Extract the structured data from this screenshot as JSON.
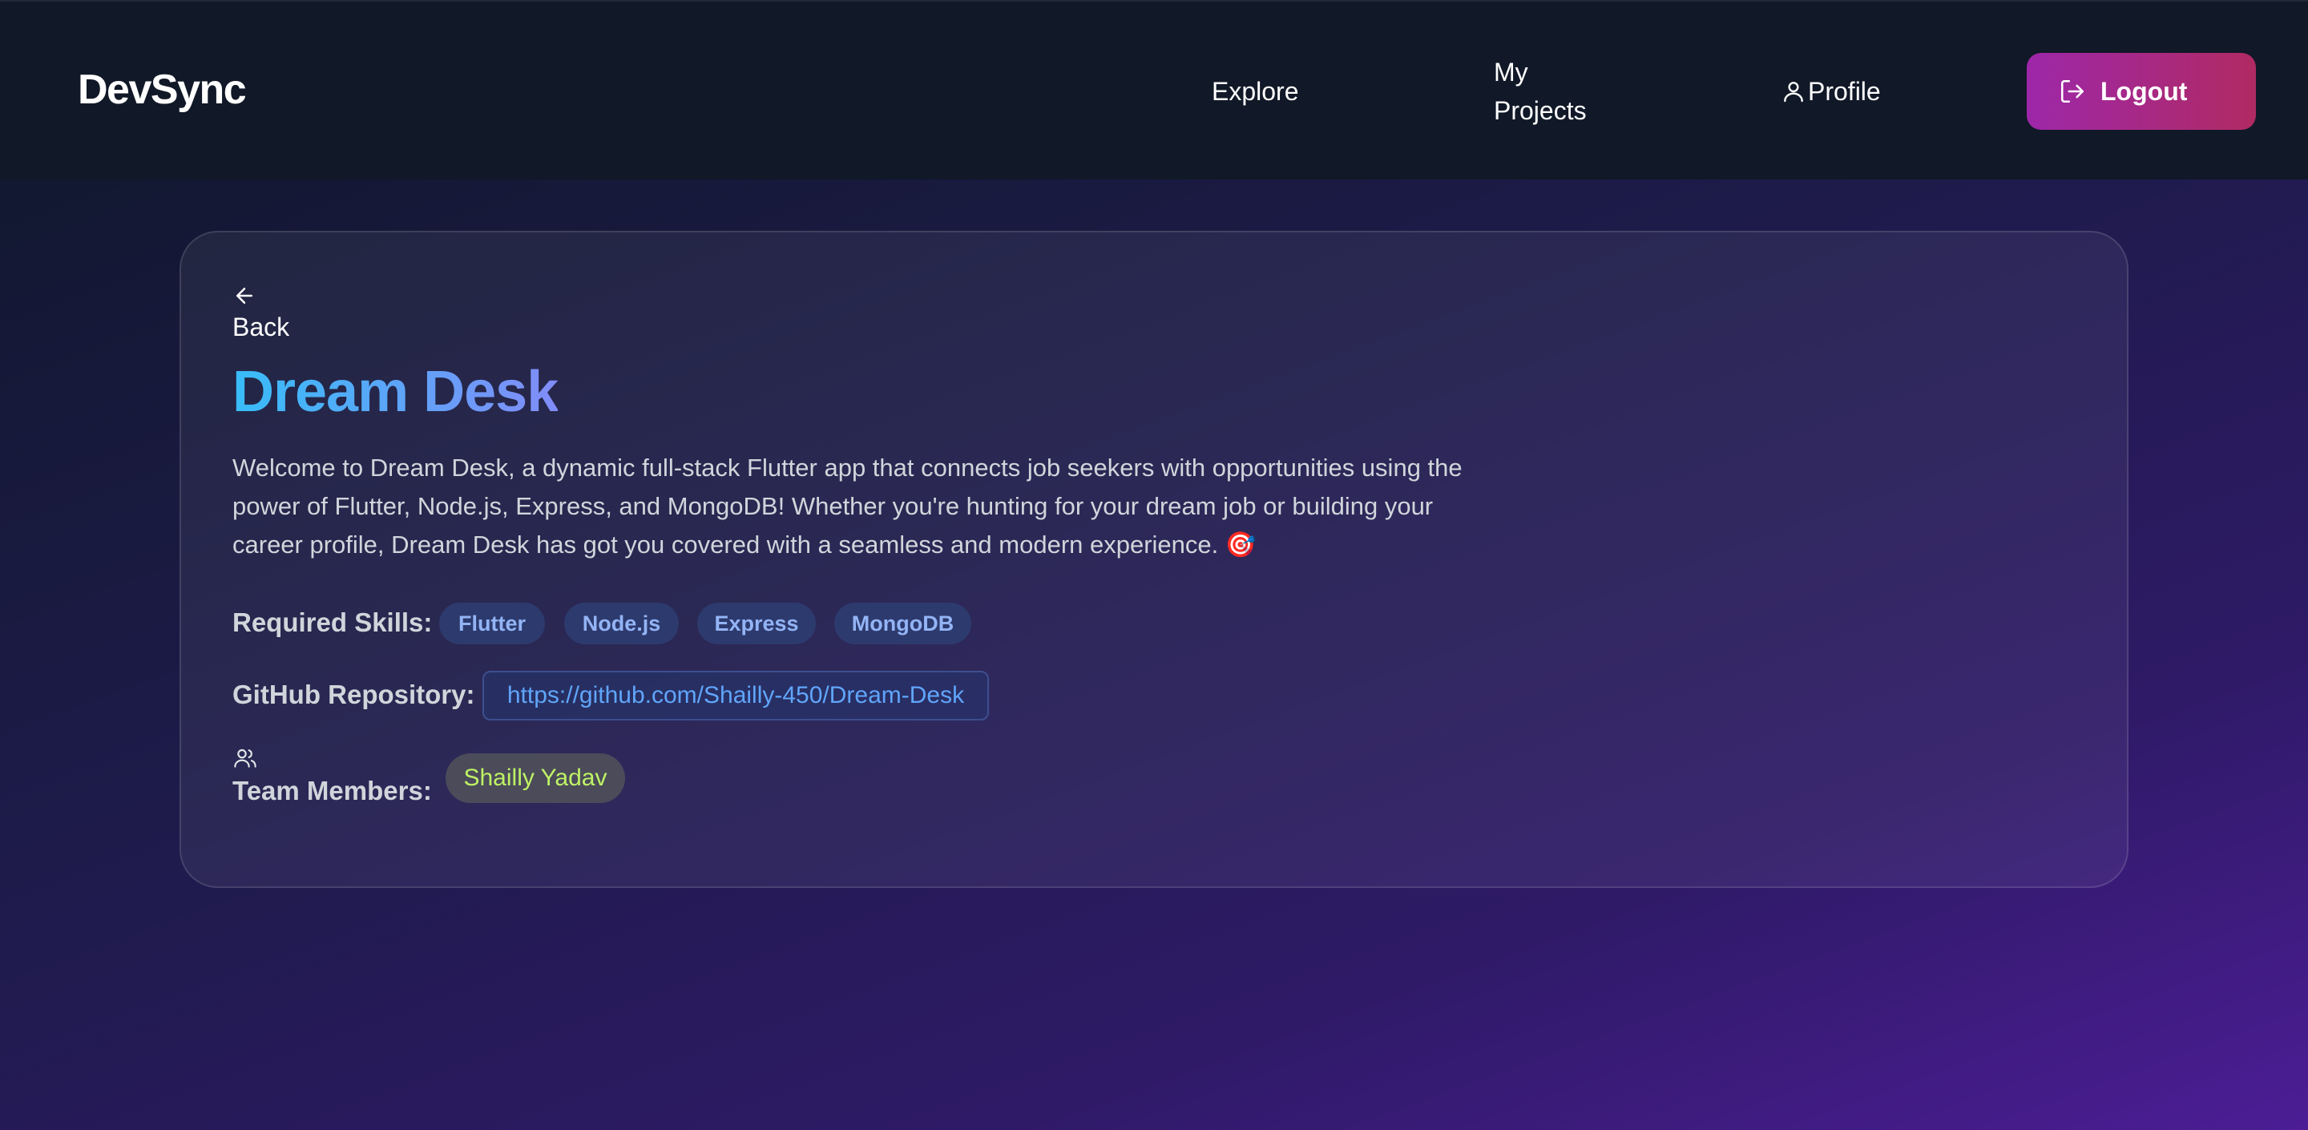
{
  "navbar": {
    "brand": "DevSync",
    "links": {
      "explore": "Explore",
      "my_projects": "My Projects",
      "profile": "Profile"
    },
    "logout_label": "Logout"
  },
  "project": {
    "back_label": "Back",
    "title": "Dream Desk",
    "description": "Welcome to Dream Desk, a dynamic full-stack Flutter app that connects job seekers with opportunities using the power of Flutter, Node.js, Express, and MongoDB! Whether you're hunting for your dream job or building your career profile, Dream Desk has got you covered with a seamless and modern experience. 🎯",
    "skills_label": "Required Skills:",
    "skills": [
      "Flutter",
      "Node.js",
      "Express",
      "MongoDB"
    ],
    "repo_label": "GitHub Repository:",
    "repo_url": "https://github.com/Shailly-450/Dream-Desk",
    "team_label": "Team Members:",
    "team_members": [
      "Shailly Yadav"
    ]
  },
  "icons": {
    "profile": "user-icon",
    "logout": "logout-icon",
    "back": "arrow-left-icon",
    "team": "users-icon"
  },
  "colors": {
    "logout_gradient_start": "#9d27a9",
    "logout_gradient_end": "#b02a62",
    "title_gradient_start": "#38bdf8",
    "title_gradient_end": "#818cf8",
    "skill_tag_bg": "#2d3a6e",
    "member_text": "#bef264"
  }
}
